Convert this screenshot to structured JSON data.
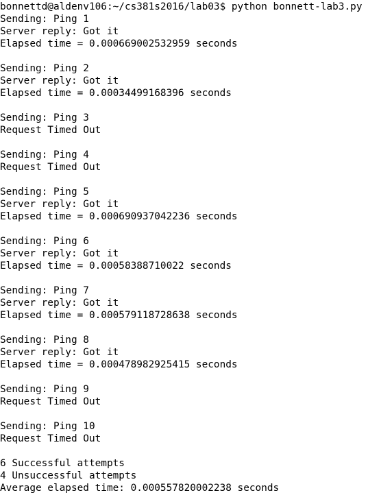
{
  "terminal": {
    "prompt": "bonnettd@aldenv106:~/cs381s2016/lab03$ python bonnett-lab3.py",
    "lines": [
      "Sending: Ping 1",
      "Server reply: Got it",
      "Elapsed time = 0.000669002532959 seconds",
      "",
      "Sending: Ping 2",
      "Server reply: Got it",
      "Elapsed time = 0.00034499168396 seconds",
      "",
      "Sending: Ping 3",
      "Request Timed Out",
      "",
      "Sending: Ping 4",
      "Request Timed Out",
      "",
      "Sending: Ping 5",
      "Server reply: Got it",
      "Elapsed time = 0.000690937042236 seconds",
      "",
      "Sending: Ping 6",
      "Server reply: Got it",
      "Elapsed time = 0.00058388710022 seconds",
      "",
      "Sending: Ping 7",
      "Server reply: Got it",
      "Elapsed time = 0.000579118728638 seconds",
      "",
      "Sending: Ping 8",
      "Server reply: Got it",
      "Elapsed time = 0.000478982925415 seconds",
      "",
      "Sending: Ping 9",
      "Request Timed Out",
      "",
      "Sending: Ping 10",
      "Request Timed Out",
      "",
      "6 Successful attempts",
      "4 Unsuccessful attempts",
      "Average elapsed time: 0.000557820002238 seconds"
    ]
  }
}
